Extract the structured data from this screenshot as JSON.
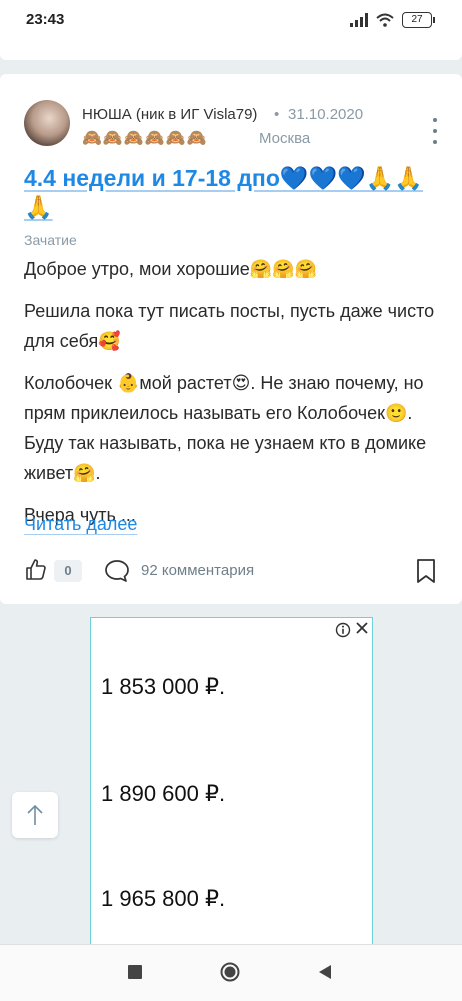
{
  "status_bar": {
    "time": "23:43",
    "battery": "27"
  },
  "post": {
    "author": "НЮША (ник в ИГ Visla79)",
    "dot": "•",
    "date": "31.10.2020",
    "author_emojis": "🙈🙈🙈🙈🙈🙈",
    "city": "Москва",
    "title": "4.4 недели и 17-18 дпо💙💙💙🙏🙏🙏",
    "category": "Зачатие",
    "paragraphs": [
      "Доброе утро, мои хорошие🤗🤗🤗",
      "Решила пока тут писать посты, пусть даже чисто для себя🥰",
      "Колобочек 👶мой растет😍. Не знаю почему, но прям приклеилось называть его Колобочек🙂. Буду так называть, пока не узнаем кто в домике живет🤗.",
      "Вчера чуть ..."
    ],
    "read_more": "Читать далее",
    "likes": "0",
    "comments": "92 комментария"
  },
  "ad": {
    "prices": [
      "1 853 000 ₽.",
      "1 890 600 ₽.",
      "1 965 800 ₽."
    ]
  },
  "colors": {
    "accent": "#1e88e5",
    "muted": "#8a9aa6",
    "background": "#e9eef1",
    "ad_border": "#6fd0d8"
  }
}
